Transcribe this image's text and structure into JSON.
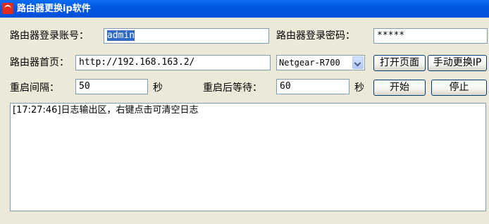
{
  "window": {
    "title": "路由器更换ip软件",
    "icon": "router-app-icon"
  },
  "form": {
    "account_label": "路由器登录账号：",
    "account_value": "admin",
    "password_label": "路由器登录密码：",
    "password_value": "*****",
    "homepage_label": "路由器首页：",
    "homepage_value": "http://192.168.163.2/",
    "model_selected": "Netgear-R700",
    "open_page_button": "打开页面",
    "manual_change_button": "手动更换IP",
    "restart_interval_label": "重启间隔：",
    "restart_interval_value": "50",
    "seconds_unit_1": "秒",
    "wait_after_restart_label": "重启后等待：",
    "wait_after_restart_value": "60",
    "seconds_unit_2": "秒",
    "start_button": "开始",
    "stop_button": "停止"
  },
  "log": {
    "lines": [
      "[17:27:46]日志输出区，右键点击可清空日志"
    ]
  },
  "colors": {
    "titlebar": "#0054e3",
    "window_bg": "#ece9d8",
    "selection": "#316ac5"
  }
}
